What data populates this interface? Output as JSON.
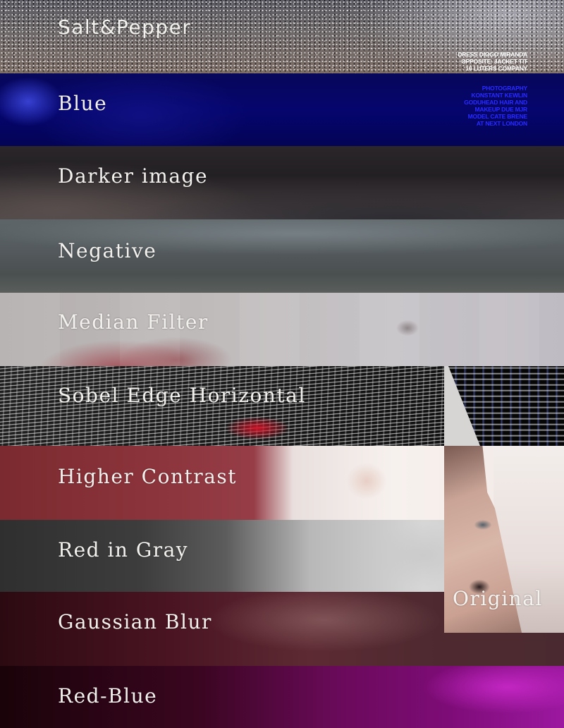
{
  "bands": [
    {
      "label": "Salt&Pepper"
    },
    {
      "label": "Blue"
    },
    {
      "label": "Darker image"
    },
    {
      "label": "Negative"
    },
    {
      "label": "Median Filter"
    },
    {
      "label": "Sobel Edge Horizontal"
    },
    {
      "label": "Higher Contrast"
    },
    {
      "label": "Red in Gray"
    },
    {
      "label": "Gaussian Blur"
    },
    {
      "label": "Red-Blue"
    }
  ],
  "original_label": "Original",
  "credits": {
    "top": [
      "DRESS DIOGO MIRANDA",
      "OPPOSITE: JACKET TIT",
      "16 LUTERS COMPANY"
    ],
    "blue": [
      "PHOTOGRAPHY",
      "KONSTANT KEWLIN",
      "GODUHEAD HAIR AND",
      "MAKEUP DUE MJR",
      "MODEL CATE BRENE",
      "AT NEXT LONDON"
    ]
  },
  "colors": {
    "label_text": "#f3f1ee",
    "credit_top": "#ffffff",
    "credit_blue": "#2a2cff"
  }
}
